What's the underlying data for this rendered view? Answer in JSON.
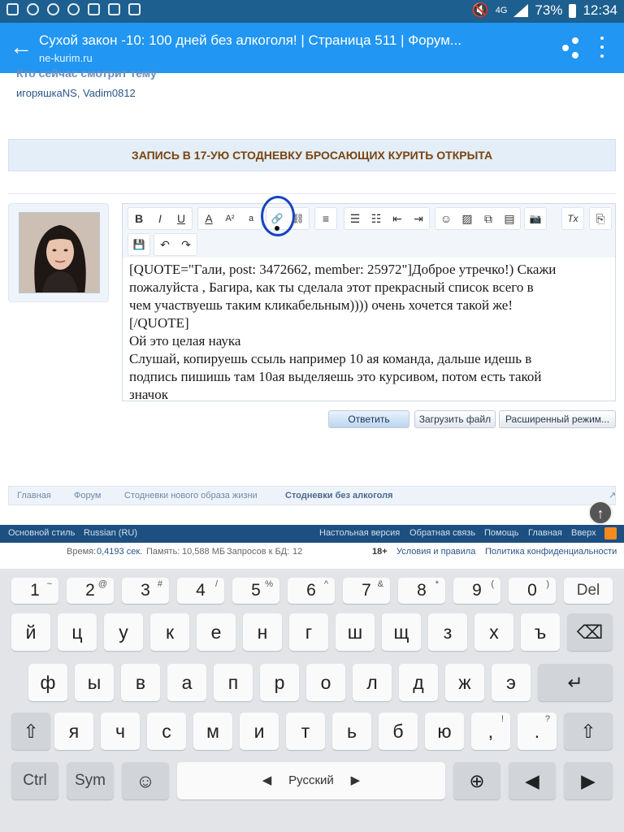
{
  "status_bar": {
    "network": "4G",
    "battery": "73%",
    "time": "12:34"
  },
  "app_bar": {
    "title": "Сухой закон -10: 100 дней без алкоголя! | Страница 511 | Форум...",
    "url": "ne-kurim.ru"
  },
  "page": {
    "partial_heading": "Кто сейчас смотрит тему",
    "viewers": "игоряшкаNS, Vadim0812",
    "notice": "ЗАПИСЬ В 17-УЮ СТОДНЕВКУ БРОСАЮЩИХ КУРИТЬ ОТКРЫТА"
  },
  "editor": {
    "toolbar_row1": [
      "B",
      "I",
      "U",
      "A",
      "A²",
      "a",
      "🔗",
      "⛓",
      "≡",
      "☰",
      "☷",
      "⇤",
      "⇥",
      "☺",
      "▨",
      "⧉",
      "▤",
      "📷",
      "Tx",
      "⎘"
    ],
    "toolbar_row2": [
      "💾",
      "↶",
      "↷"
    ],
    "lines": [
      "[QUOTE=\"Гали, post: 3472662, member: 25972\"]Доброе утречко!) Скажи",
      "пожалуйста , Багира, как ты сделала этот прекрасный список всего в",
      "чем участвуешь таким кликабельным)))) очень хочется такой же!",
      "[/QUOTE]",
      "Ой это целая наука",
      "Слушай, копируешь ссыль например 10 ая команда, дальше идешь в",
      "подпись пишишь там 10ая выделяешь это курсивом, потом есть такой",
      "значок"
    ]
  },
  "buttons": {
    "reply": "Ответить",
    "upload": "Загрузить файл",
    "advanced": "Расширенный режим..."
  },
  "breadcrumb": [
    "Главная",
    "Форум",
    "Стодневки нового образа жизни",
    "Стодневки без алкоголя"
  ],
  "footer": {
    "style": "Основной стиль",
    "language": "Russian (RU)",
    "links": [
      "Настольная версия",
      "Обратная связь",
      "Помощь",
      "Главная",
      "Вверх"
    ]
  },
  "stats": {
    "time_label": "Время:",
    "time_value": "0,4193 сек.",
    "memory_label": "Память:",
    "memory_value": "10,588 МБ",
    "queries_label": "Запросов к БД:",
    "queries_value": "12",
    "age": "18+",
    "terms": "Условия и правила",
    "privacy": "Политика конфиденциальности"
  },
  "keyboard": {
    "numbers": [
      {
        "main": "1",
        "sup": "~"
      },
      {
        "main": "2",
        "sup": "@"
      },
      {
        "main": "3",
        "sup": "#"
      },
      {
        "main": "4",
        "sup": "/"
      },
      {
        "main": "5",
        "sup": "%"
      },
      {
        "main": "6",
        "sup": "^"
      },
      {
        "main": "7",
        "sup": "&"
      },
      {
        "main": "8",
        "sup": "*"
      },
      {
        "main": "9",
        "sup": "("
      },
      {
        "main": "0",
        "sup": ")"
      }
    ],
    "del": "Del",
    "row1": [
      "й",
      "ц",
      "у",
      "к",
      "е",
      "н",
      "г",
      "ш",
      "щ",
      "з",
      "х",
      "ъ"
    ],
    "row2": [
      "ф",
      "ы",
      "в",
      "а",
      "п",
      "р",
      "о",
      "л",
      "д",
      "ж",
      "э"
    ],
    "row3": [
      "я",
      "ч",
      "с",
      "м",
      "и",
      "т",
      "ь",
      "б",
      "ю"
    ],
    "punct1": ",",
    "punct1_sup": "!",
    "punct2": ".",
    "punct2_sup": "?",
    "ctrl": "Ctrl",
    "sym": "Sym",
    "space_language": "Русский"
  },
  "colors": {
    "status_bar": "#1d5f8f",
    "app_bar": "#2196f3",
    "footer": "#1d4f80",
    "notice_text": "#7a4410",
    "annotation": "#1843c2"
  }
}
